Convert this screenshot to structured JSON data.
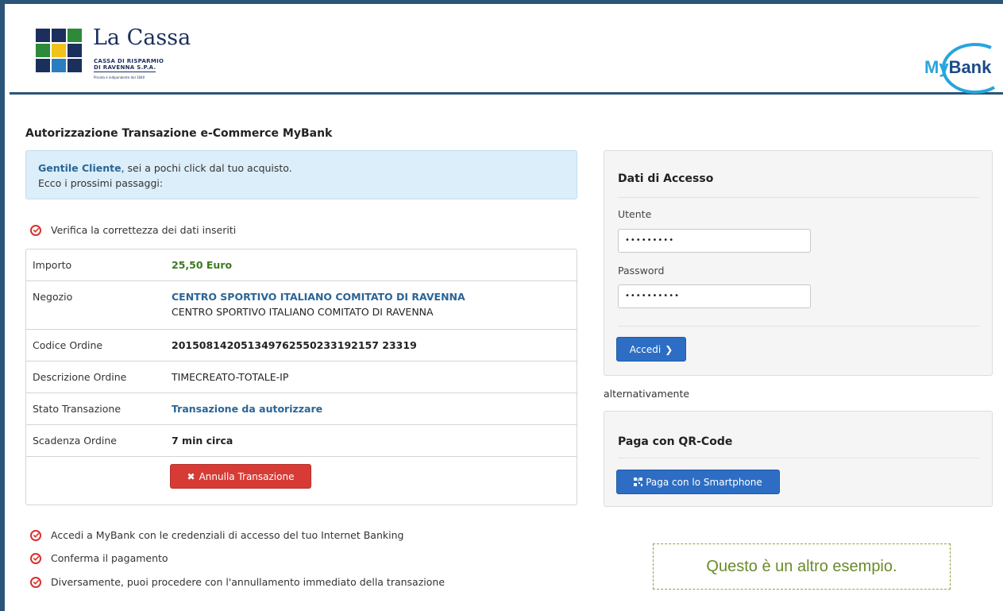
{
  "header": {
    "bank_name": "La Cassa",
    "bank_line1": "CASSA DI RISPARMIO",
    "bank_line2": "DI RAVENNA S.P.A.",
    "bank_tagline": "Privata e indipendente dal 1840",
    "mybank_label": "MyBank"
  },
  "page_title": "Autorizzazione Transazione e-Commerce MyBank",
  "info": {
    "greeting": "Gentile Cliente",
    "line1_rest": ", sei a pochi click dal tuo acquisto.",
    "line2": "Ecco i prossimi passaggi:"
  },
  "step_verify": "Verifica la correttezza dei dati inseriti",
  "details": {
    "importo_label": "Importo",
    "importo_value": "25,50 Euro",
    "negozio_label": "Negozio",
    "negozio_value": "CENTRO SPORTIVO ITALIANO COMITATO DI RAVENNA",
    "negozio_value2": "CENTRO SPORTIVO ITALIANO COMITATO DI RAVENNA",
    "codice_label": "Codice Ordine",
    "codice_value": "201508142051349762550233192157 23319",
    "descrizione_label": "Descrizione Ordine",
    "descrizione_value": "TIMECREATO-TOTALE-IP",
    "stato_label": "Stato Transazione",
    "stato_value": "Transazione da autorizzare",
    "scadenza_label": "Scadenza Ordine",
    "scadenza_value": "7 min circa",
    "cancel_label": "Annulla Transazione"
  },
  "steps": [
    "Accedi a MyBank con le credenziali di accesso del tuo Internet Banking",
    "Conferma il pagamento",
    "Diversamente, puoi procedere con l'annullamento immediato della transazione"
  ],
  "login": {
    "title": "Dati di Accesso",
    "user_label": "Utente",
    "user_value": "•••••••••",
    "password_label": "Password",
    "password_value": "••••••••••",
    "submit_label": "Accedi"
  },
  "alternative_text": "alternativamente",
  "qr": {
    "title": "Paga con QR-Code",
    "button_label": "Paga con lo Smartphone"
  },
  "note": "Questo è un altro esempio.",
  "colors": {
    "frame": "#2a5578",
    "info_bg": "#dceefa",
    "danger": "#d73b36",
    "primary": "#2d6ec4",
    "note": "#6b8a2a"
  }
}
